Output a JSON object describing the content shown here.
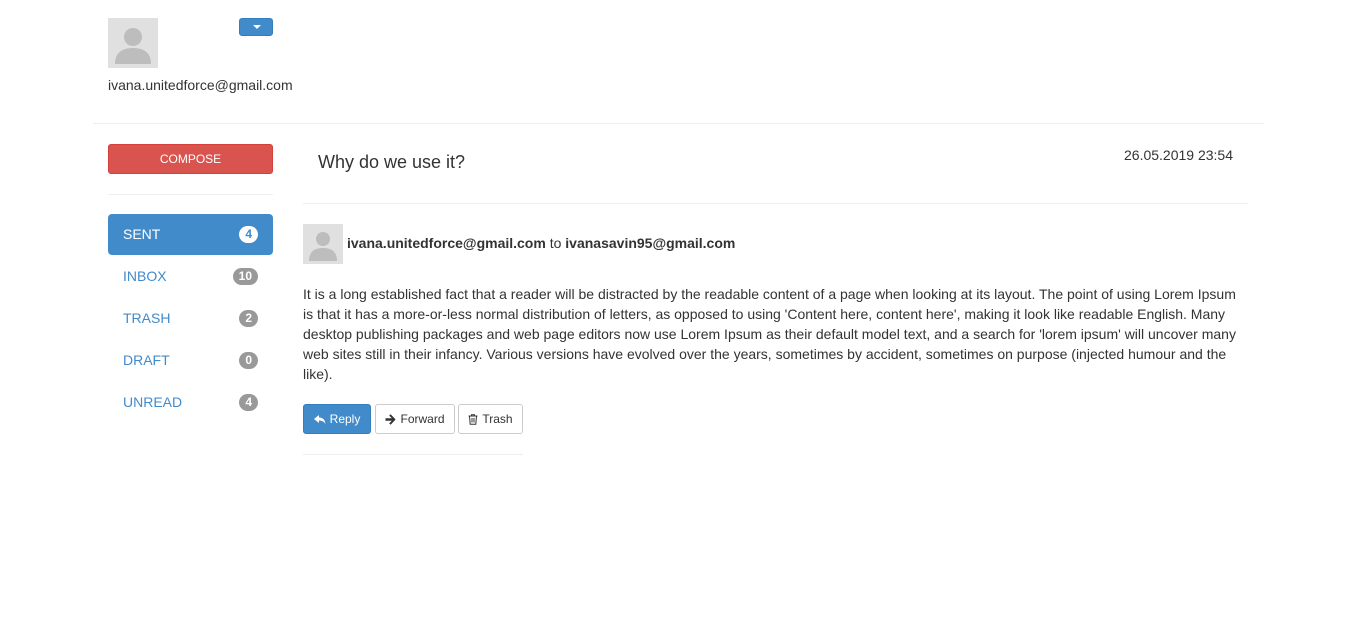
{
  "user": {
    "email": "ivana.unitedforce@gmail.com",
    "avatar_icon": "user-avatar-icon",
    "menu_icon": "caret-down-icon"
  },
  "sidebar": {
    "compose_label": "COMPOSE",
    "items": [
      {
        "label": "SENT",
        "count": "4",
        "active": true
      },
      {
        "label": "INBOX",
        "count": "10",
        "active": false
      },
      {
        "label": "TRASH",
        "count": "2",
        "active": false
      },
      {
        "label": "DRAFT",
        "count": "0",
        "active": false
      },
      {
        "label": "UNREAD",
        "count": "4",
        "active": false
      }
    ]
  },
  "message": {
    "subject": "Why do we use it?",
    "date": "26.05.2019 23:54",
    "from": "ivana.unitedforce@gmail.com",
    "to_word": "to",
    "to": "ivanasavin95@gmail.com",
    "body": "It is a long established fact that a reader will be distracted by the readable content of a page when looking at its layout. The point of using Lorem Ipsum is that it has a more-or-less normal distribution of letters, as opposed to using 'Content here, content here', making it look like readable English. Many desktop publishing packages and web page editors now use Lorem Ipsum as their default model text, and a search for 'lorem ipsum' will uncover many web sites still in their infancy. Various versions have evolved over the years, sometimes by accident, sometimes on purpose (injected humour and the like)."
  },
  "actions": {
    "reply_label": "Reply",
    "forward_label": "Forward",
    "trash_label": "Trash"
  },
  "colors": {
    "primary": "#428bca",
    "danger": "#d9534f",
    "badge": "#999999"
  }
}
